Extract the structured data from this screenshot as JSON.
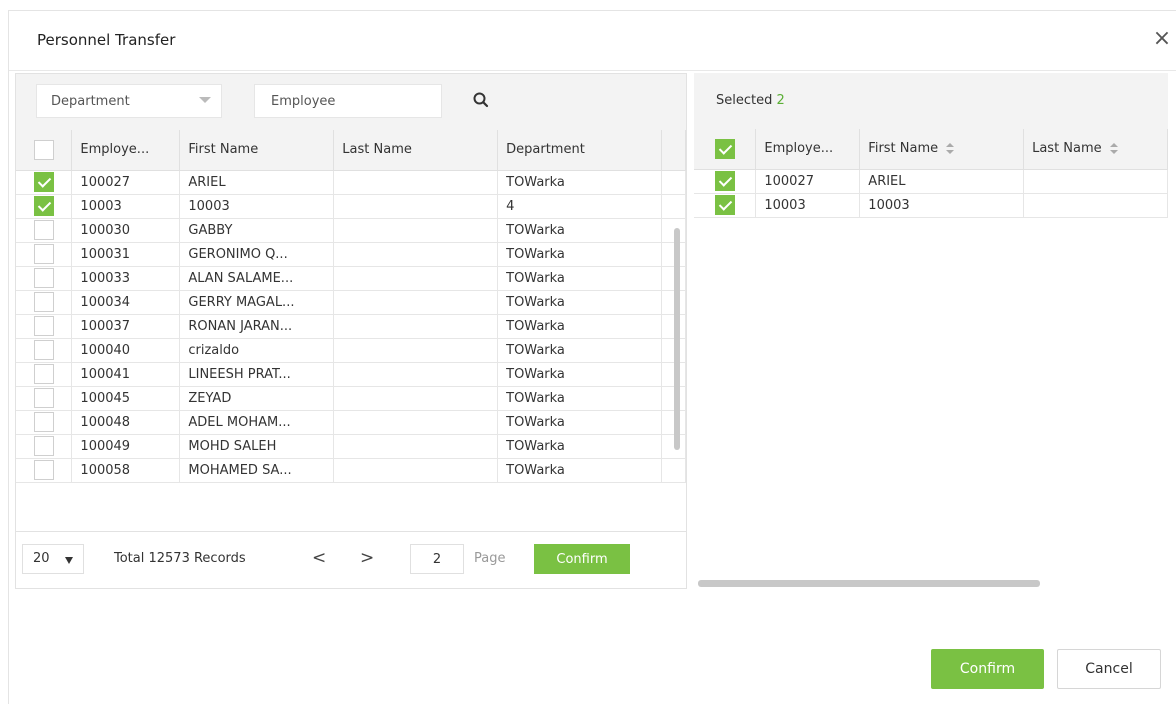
{
  "dialog": {
    "title": "Personnel Transfer",
    "close_symbol": "×",
    "confirm_label": "Confirm",
    "cancel_label": "Cancel",
    "brand_color": "#7ac143"
  },
  "filters": {
    "department_placeholder": "Department",
    "employee_placeholder": "Employee",
    "search_icon": "search-icon"
  },
  "left_table": {
    "columns": [
      "Employe...",
      "First Name",
      "Last Name",
      "Department"
    ],
    "rows": [
      {
        "checked": true,
        "id": "100027",
        "first": "ARIEL",
        "last": "",
        "dept": "TOWarka"
      },
      {
        "checked": true,
        "id": "10003",
        "first": "10003",
        "last": "",
        "dept": "4"
      },
      {
        "checked": false,
        "id": "100030",
        "first": "GABBY",
        "last": "",
        "dept": "TOWarka"
      },
      {
        "checked": false,
        "id": "100031",
        "first": "GERONIMO Q...",
        "last": "",
        "dept": "TOWarka"
      },
      {
        "checked": false,
        "id": "100033",
        "first": "ALAN SALAME...",
        "last": "",
        "dept": "TOWarka"
      },
      {
        "checked": false,
        "id": "100034",
        "first": "GERRY MAGAL...",
        "last": "",
        "dept": "TOWarka"
      },
      {
        "checked": false,
        "id": "100037",
        "first": "RONAN JARAN...",
        "last": "",
        "dept": "TOWarka"
      },
      {
        "checked": false,
        "id": "100040",
        "first": "crizaldo",
        "last": "",
        "dept": "TOWarka"
      },
      {
        "checked": false,
        "id": "100041",
        "first": "LINEESH PRAT...",
        "last": "",
        "dept": "TOWarka"
      },
      {
        "checked": false,
        "id": "100045",
        "first": "ZEYAD",
        "last": "",
        "dept": "TOWarka"
      },
      {
        "checked": false,
        "id": "100048",
        "first": "ADEL MOHAM...",
        "last": "",
        "dept": "TOWarka"
      },
      {
        "checked": false,
        "id": "100049",
        "first": "MOHD SALEH",
        "last": "",
        "dept": "TOWarka"
      },
      {
        "checked": false,
        "id": "100058",
        "first": "MOHAMED SA...",
        "last": "",
        "dept": "TOWarka"
      }
    ]
  },
  "pager": {
    "page_size": "20",
    "total_text": "Total 12573 Records",
    "prev_symbol": "<",
    "next_symbol": ">",
    "page_value": "2",
    "page_label": "Page",
    "confirm_label": "Confirm"
  },
  "right_panel": {
    "selected_label": "Selected",
    "selected_count": "2",
    "columns": [
      "Employe...",
      "First Name",
      "Last Name"
    ],
    "rows": [
      {
        "checked": true,
        "id": "100027",
        "first": "ARIEL",
        "last": ""
      },
      {
        "checked": true,
        "id": "10003",
        "first": "10003",
        "last": ""
      }
    ]
  }
}
